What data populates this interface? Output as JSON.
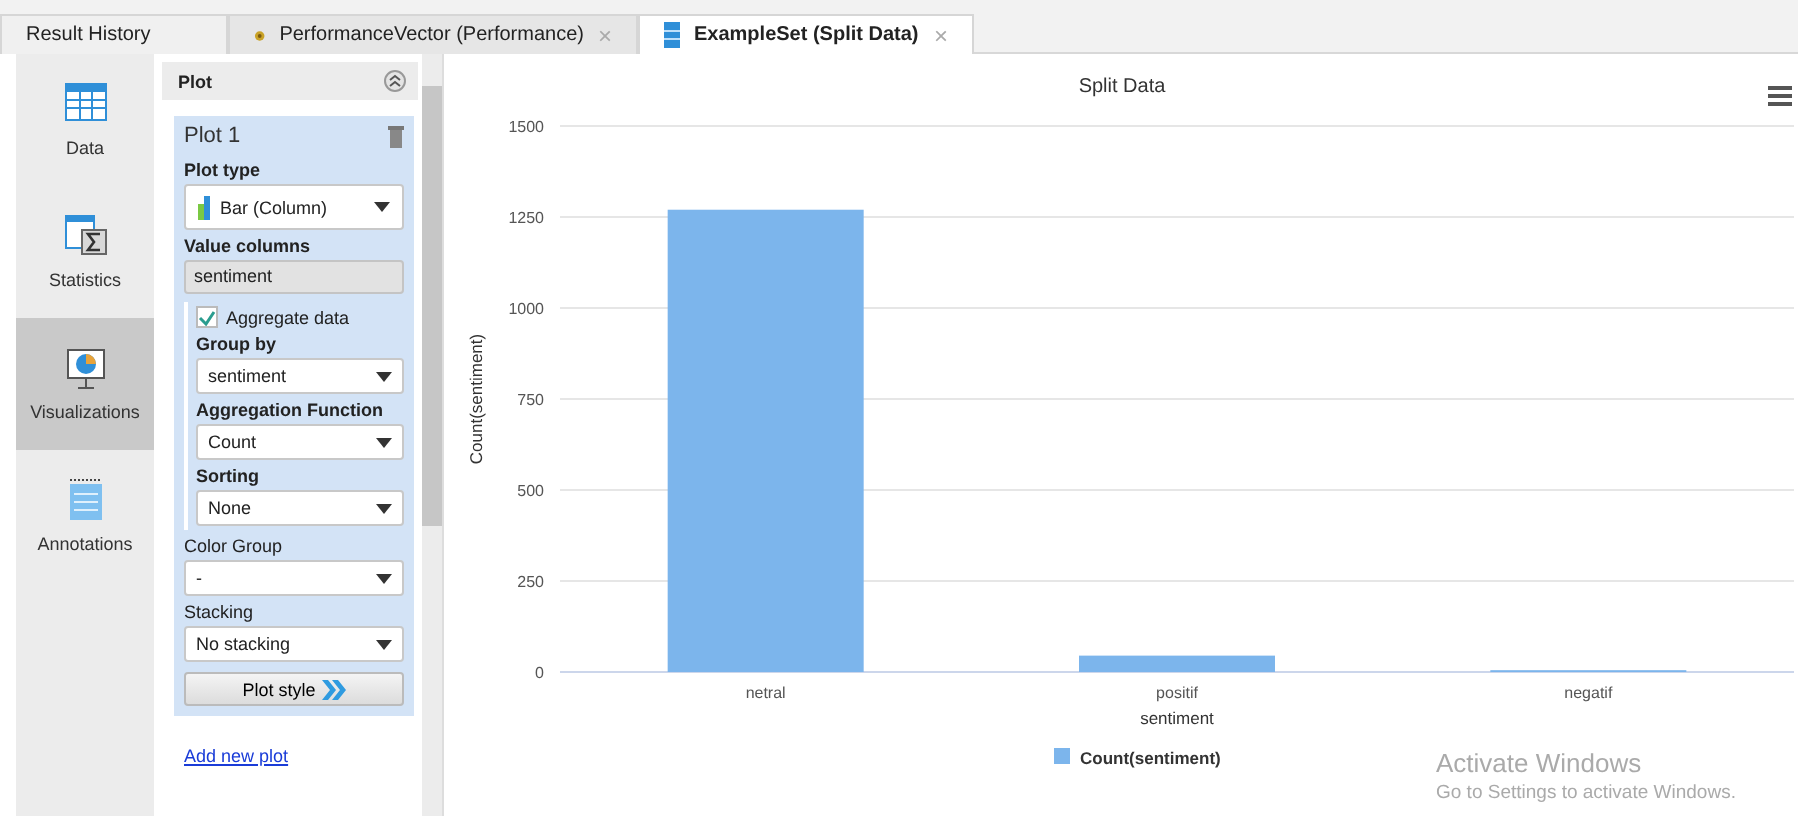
{
  "tabs": [
    {
      "label": "Result History",
      "selected": false,
      "closable": false
    },
    {
      "label": "PerformanceVector (Performance)",
      "selected": false,
      "closable": true
    },
    {
      "label": "ExampleSet (Split Data)",
      "selected": true,
      "closable": true
    }
  ],
  "close_glyph": "×",
  "nav": [
    {
      "label": "Data",
      "selected": false
    },
    {
      "label": "Statistics",
      "selected": false
    },
    {
      "label": "Visualizations",
      "selected": true
    },
    {
      "label": "Annotations",
      "selected": false
    }
  ],
  "panel": {
    "title": "Plot",
    "plot_name": "Plot 1",
    "plot_type_label": "Plot type",
    "plot_type": "Bar (Column)",
    "value_columns_label": "Value columns",
    "value_column": "sentiment",
    "aggregate": {
      "label": "Aggregate data",
      "checked": true
    },
    "group_by_label": "Group by",
    "group_by": "sentiment",
    "aggregation_label": "Aggregation Function",
    "aggregation": "Count",
    "sorting_label": "Sorting",
    "sorting": "None",
    "color_group_label": "Color Group",
    "color_group": "-",
    "stacking_label": "Stacking",
    "stacking": "No stacking",
    "plot_style_button": "Plot style",
    "add_plot_link": "Add new plot"
  },
  "chart": {
    "chart_data": {
      "type": "bar",
      "title": "Split Data",
      "xlabel": "sentiment",
      "ylabel": "Count(sentiment)",
      "categories": [
        "netral",
        "positif",
        "negatif"
      ],
      "series": [
        {
          "name": "Count(sentiment)",
          "color": "#7cb5ec",
          "values": [
            1270,
            45,
            5
          ]
        }
      ],
      "ylim": [
        0,
        1500
      ],
      "grid": true,
      "yticks": [
        0,
        250,
        500,
        750,
        1000,
        1250,
        1500
      ]
    }
  },
  "os_notice": {
    "title": "Activate Windows",
    "text": "Go to Settings to activate Windows."
  }
}
